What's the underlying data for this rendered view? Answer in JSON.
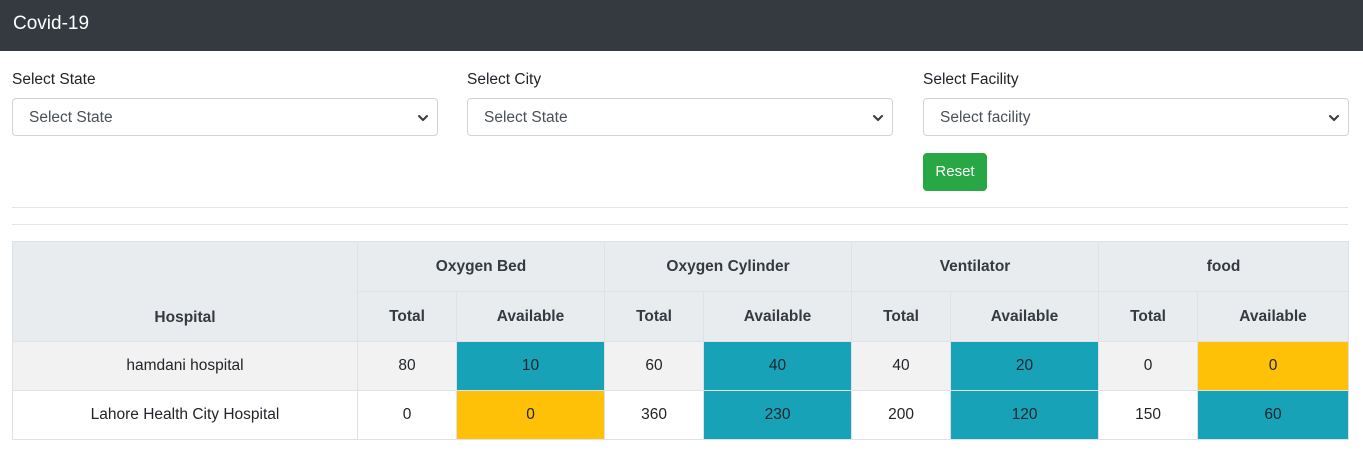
{
  "navbar": {
    "brand": "Covid-19"
  },
  "filters": {
    "state": {
      "label": "Select State",
      "value": "Select State"
    },
    "city": {
      "label": "Select City",
      "value": "Select State"
    },
    "facility": {
      "label": "Select Facility",
      "value": "Select facility"
    },
    "reset_label": "Reset"
  },
  "table": {
    "hospital_header": "Hospital",
    "groups": [
      "Oxygen Bed",
      "Oxygen Cylinder",
      "Ventilator",
      "food"
    ],
    "sub_total": "Total",
    "sub_available": "Available",
    "rows": [
      {
        "hospital": "hamdani hospital",
        "cells": [
          "80",
          "10",
          "60",
          "40",
          "40",
          "20",
          "0",
          "0"
        ]
      },
      {
        "hospital": "Lahore Health City Hospital",
        "cells": [
          "0",
          "0",
          "360",
          "230",
          "200",
          "120",
          "150",
          "60"
        ]
      }
    ]
  },
  "colors": {
    "available_ok": "#17a2b8",
    "available_empty": "#ffc107",
    "reset_button": "#28a745",
    "navbar": "#343a40"
  }
}
